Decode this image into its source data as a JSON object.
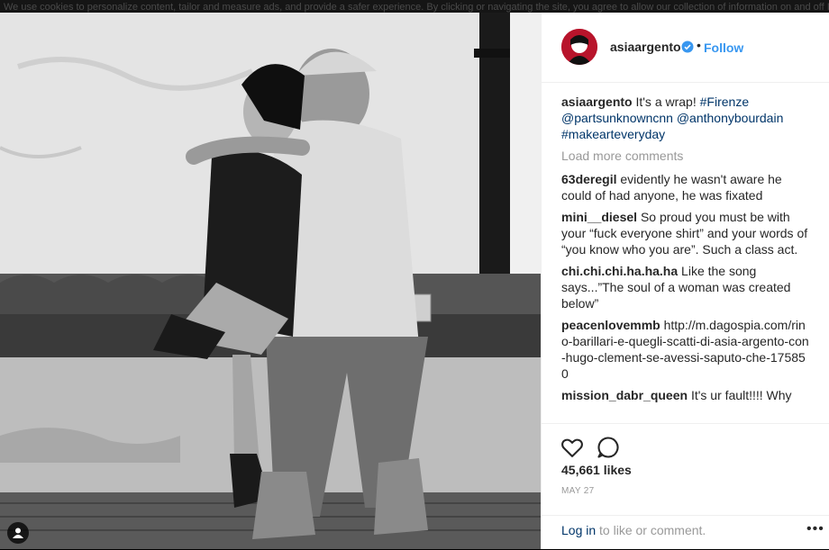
{
  "cookie_notice": "We use cookies to personalize content, tailor and measure ads, and provide a safer experience. By clicking or navigating the site, you agree to allow our collection of information on and off Instagram through cookies. Learn more, including about available controls: Cookies Policy.",
  "post": {
    "username": "asiaargento",
    "follow_label": "Follow",
    "dot": "•",
    "caption": {
      "username": "asiaargento",
      "text": "It's a wrap!",
      "tag1": "#Firenze",
      "mention1": "@partsunknowncnn",
      "mention2": "@anthonybourdain",
      "tag2": "#makearteveryday"
    },
    "load_more": "Load more comments",
    "comments": [
      {
        "user": "63deregil",
        "text": "evidently he wasn't aware he could of had anyone, he was fixated"
      },
      {
        "user": "mini__diesel",
        "text": "So proud you must be with your “fuck everyone shirt” and your words of “you know who you are”. Such a class act."
      },
      {
        "user": "chi.chi.chi.ha.ha.ha",
        "text": "Like the song says...”The soul of a woman was created below”"
      },
      {
        "user": "peacenlovemmb",
        "text": "http://m.dagospia.com/rino-barillari-e-quegli-scatti-di-asia-argento-con-hugo-clement-se-avessi-saputo-che-175850"
      },
      {
        "user": "mission_dabr_queen",
        "text": "It's ur fault!!!! Why"
      }
    ],
    "likes": "45,661 likes",
    "date": "MAY 27",
    "login_link": "Log in",
    "login_rest": " to like or comment.",
    "more_options": "•••"
  },
  "icons": {
    "like": "heart-icon",
    "comment": "speech-bubble-icon",
    "verified": "verified-badge-icon",
    "user_tag": "user-tag-icon",
    "more": "more-options-icon"
  },
  "colors": {
    "follow": "#3897f0",
    "link": "#003569",
    "avatar_bg": "#b8142b",
    "muted": "#999999",
    "text": "#262626"
  }
}
